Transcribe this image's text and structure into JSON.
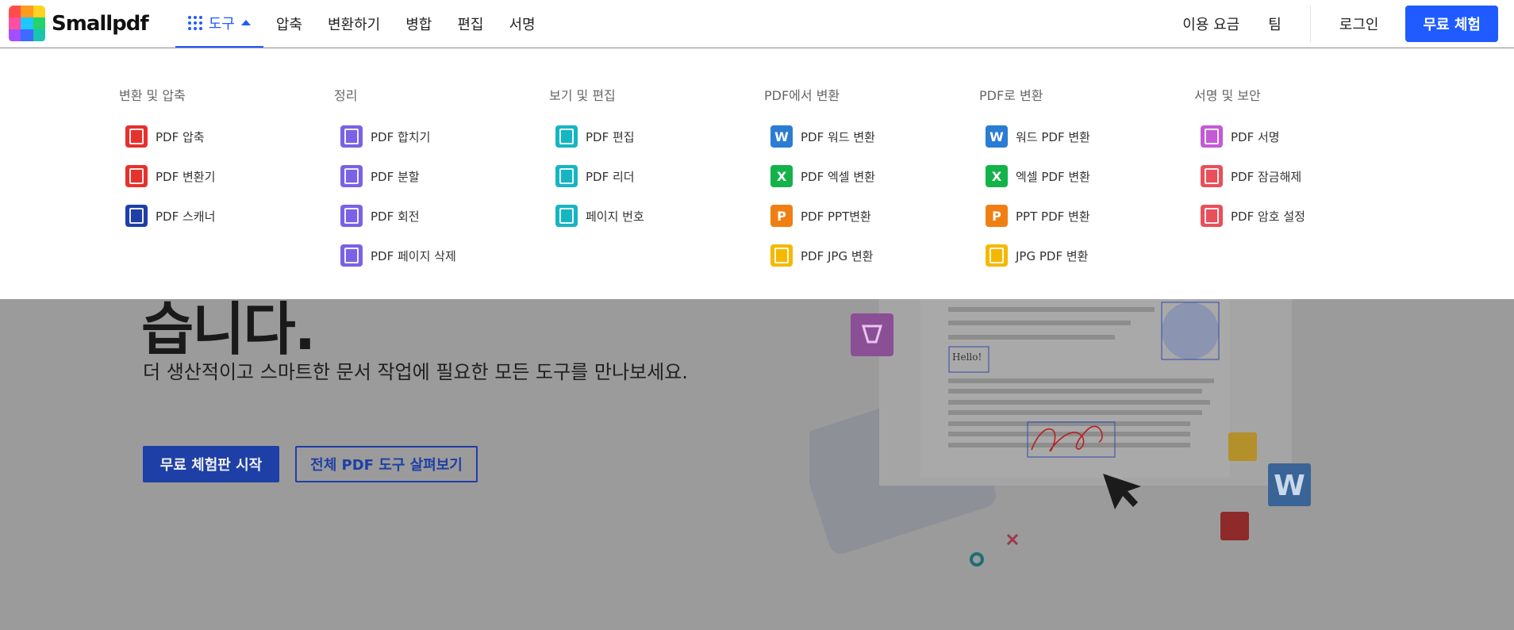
{
  "header": {
    "logo_text": "Smallpdf",
    "nav": {
      "tools": "도구",
      "compress": "압축",
      "convert": "변환하기",
      "merge": "병합",
      "edit": "편집",
      "sign": "서명"
    },
    "right": {
      "pricing": "이용 요금",
      "team": "팀",
      "login": "로그인",
      "trial": "무료 체험"
    },
    "accent_color": "#1f5bff"
  },
  "menu": {
    "columns": [
      {
        "title": "변환 및 압축",
        "items": [
          {
            "label": "PDF 압축",
            "icon": "compress-icon",
            "color": "#e5322d"
          },
          {
            "label": "PDF 변환기",
            "icon": "converter-icon",
            "color": "#e5322d"
          },
          {
            "label": "PDF 스캐너",
            "icon": "camera-icon",
            "color": "#1e3fa6"
          }
        ]
      },
      {
        "title": "정리",
        "items": [
          {
            "label": "PDF 합치기",
            "icon": "merge-icon",
            "color": "#7b61e6"
          },
          {
            "label": "PDF 분할",
            "icon": "scissors-icon",
            "color": "#7b61e6"
          },
          {
            "label": "PDF 회전",
            "icon": "rotate-icon",
            "color": "#7b61e6"
          },
          {
            "label": "PDF 페이지 삭제",
            "icon": "trash-icon",
            "color": "#7b61e6"
          }
        ]
      },
      {
        "title": "보기 및 편집",
        "items": [
          {
            "label": "PDF 편집",
            "icon": "text-icon",
            "color": "#16b5c2"
          },
          {
            "label": "PDF 리더",
            "icon": "reader-icon",
            "color": "#16b5c2"
          },
          {
            "label": "페이지 번호",
            "icon": "page-number-icon",
            "color": "#16b5c2"
          }
        ]
      },
      {
        "title": "PDF에서 변환",
        "items": [
          {
            "label": "PDF 워드 변환",
            "icon": "word-icon",
            "color": "#2b7cd3",
            "glyph": "W"
          },
          {
            "label": "PDF 엑셀 변환",
            "icon": "excel-icon",
            "color": "#13b34a",
            "glyph": "X"
          },
          {
            "label": "PDF PPT변환",
            "icon": "ppt-icon",
            "color": "#f07f13",
            "glyph": "P"
          },
          {
            "label": "PDF JPG 변환",
            "icon": "image-icon",
            "color": "#f5b800"
          }
        ]
      },
      {
        "title": "PDF로 변환",
        "items": [
          {
            "label": "워드 PDF 변환",
            "icon": "word-icon",
            "color": "#2b7cd3",
            "glyph": "W"
          },
          {
            "label": "엑셀 PDF 변환",
            "icon": "excel-icon",
            "color": "#13b34a",
            "glyph": "X"
          },
          {
            "label": "PPT PDF 변환",
            "icon": "ppt-icon",
            "color": "#f07f13",
            "glyph": "P"
          },
          {
            "label": "JPG PDF 변환",
            "icon": "image-icon",
            "color": "#f5b800"
          }
        ]
      },
      {
        "title": "서명 및 보안",
        "items": [
          {
            "label": "PDF 서명",
            "icon": "signature-icon",
            "color": "#c35ad6"
          },
          {
            "label": "PDF 잠금해제",
            "icon": "unlock-icon",
            "color": "#e8505b"
          },
          {
            "label": "PDF 암호 설정",
            "icon": "lock-icon",
            "color": "#e8505b"
          }
        ]
      }
    ]
  },
  "hero": {
    "title_fragment": "습니다.",
    "subtitle": "더 생산적이고 스마트한 문서 작업에 필요한 모든 도구를 만나보세요.",
    "primary_button": "무료 체험판 시작",
    "secondary_button": "전체 PDF 도구 살펴보기",
    "illustration_text": "Hello!"
  }
}
